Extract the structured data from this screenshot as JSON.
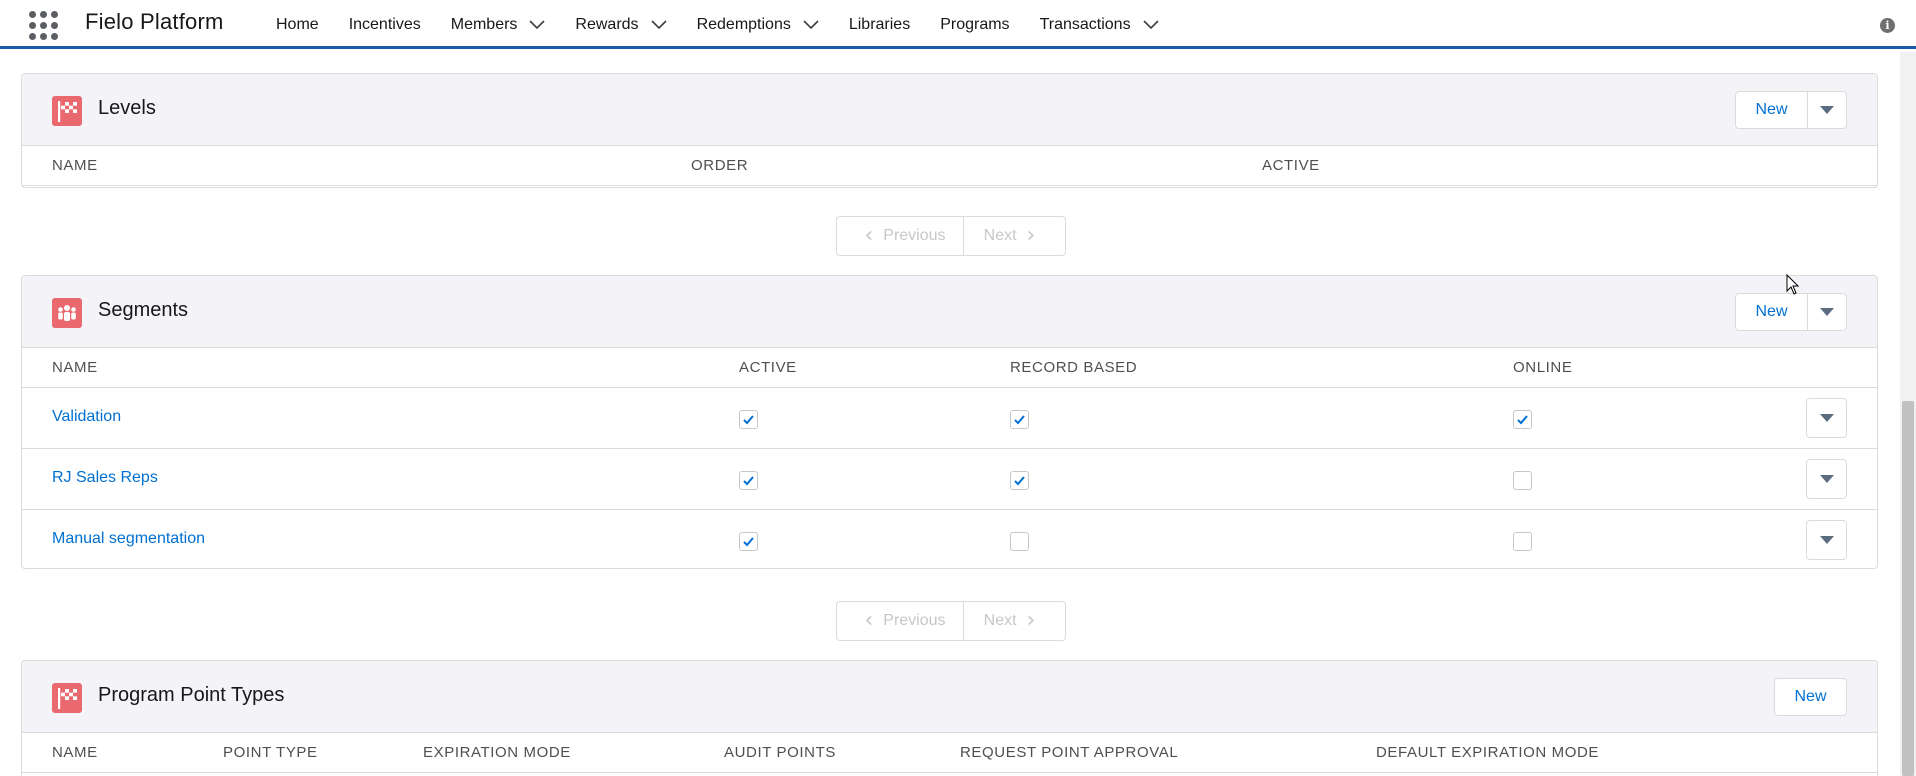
{
  "app": {
    "name": "Fielo Platform"
  },
  "nav": {
    "items": [
      {
        "label": "Home",
        "dropdown": false
      },
      {
        "label": "Incentives",
        "dropdown": false
      },
      {
        "label": "Members",
        "dropdown": true
      },
      {
        "label": "Rewards",
        "dropdown": true
      },
      {
        "label": "Redemptions",
        "dropdown": true
      },
      {
        "label": "Libraries",
        "dropdown": false
      },
      {
        "label": "Programs",
        "dropdown": false
      },
      {
        "label": "Transactions",
        "dropdown": true
      }
    ]
  },
  "levels": {
    "title": "Levels",
    "new_label": "New",
    "columns": [
      "NAME",
      "ORDER",
      "ACTIVE"
    ],
    "pager": {
      "previous": "Previous",
      "next": "Next"
    }
  },
  "segments": {
    "title": "Segments",
    "new_label": "New",
    "columns": [
      "NAME",
      "ACTIVE",
      "RECORD BASED",
      "ONLINE"
    ],
    "rows": [
      {
        "name": "Validation",
        "active": true,
        "record_based": true,
        "online": true
      },
      {
        "name": "RJ Sales Reps",
        "active": true,
        "record_based": true,
        "online": false
      },
      {
        "name": "Manual segmentation",
        "active": true,
        "record_based": false,
        "online": false
      }
    ],
    "pager": {
      "previous": "Previous",
      "next": "Next"
    }
  },
  "point_types": {
    "title": "Program Point Types",
    "new_label": "New",
    "columns": [
      "NAME",
      "POINT TYPE",
      "EXPIRATION MODE",
      "AUDIT POINTS",
      "REQUEST POINT APPROVAL",
      "DEFAULT EXPIRATION MODE"
    ]
  },
  "colors": {
    "accent": "#0070d2",
    "nav_border": "#1b5aa6",
    "icon_bg": "#e9696e",
    "header_bg": "#f3f3f8"
  },
  "icons": {
    "app_launcher": "waffle-icon",
    "levels": "checkered-flag-icon",
    "segments": "people-group-icon",
    "point_types": "checkered-flag-icon",
    "info": "info-icon"
  }
}
